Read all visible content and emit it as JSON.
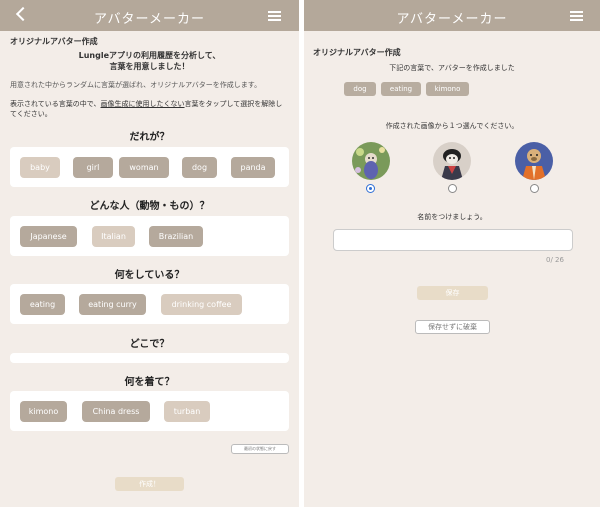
{
  "left": {
    "header": {
      "title": "アバターメーカー"
    },
    "heading": "オリジナルアバター作成",
    "intro_line1": "Lungleアプリの利用履歴を分析して、",
    "intro_line2": "言葉を用意しました！",
    "desc": "用意された中からランダムに言葉が選ばれ、オリジナルアバターを作成します。",
    "instruction_1": "表示されている言葉の中で、",
    "instruction_link": "画像生成に使用したくない",
    "instruction_2": "言葉をタップして選択を解除し",
    "instruction_3": "てください。",
    "sections": [
      {
        "title": "だれが？",
        "chips": [
          {
            "label": "baby",
            "active": false
          },
          {
            "label": "girl",
            "active": true
          },
          {
            "label": "woman",
            "active": true
          },
          {
            "label": "dog",
            "active": true
          },
          {
            "label": "panda",
            "active": true
          }
        ]
      },
      {
        "title": "どんな人（動物・もの）？",
        "chips": [
          {
            "label": "Japanese",
            "active": true
          },
          {
            "label": "Italian",
            "active": false
          },
          {
            "label": "Brazilian",
            "active": true
          }
        ]
      },
      {
        "title": "何をしている？",
        "chips": [
          {
            "label": "eating",
            "active": true
          },
          {
            "label": "eating curry",
            "active": true
          },
          {
            "label": "drinking coffee",
            "active": false
          }
        ]
      },
      {
        "title": "どこで？",
        "chips": []
      },
      {
        "title": "何を着て？",
        "chips": [
          {
            "label": "kimono",
            "active": true
          },
          {
            "label": "China dress",
            "active": true
          },
          {
            "label": "turban",
            "active": false
          }
        ]
      }
    ],
    "reset_label": "最初の状態に戻す",
    "create_label": "作成！"
  },
  "right": {
    "header": {
      "title": "アバターメーカー"
    },
    "heading": "オリジナルアバター作成",
    "created_with": "下記の言葉で、アバターを作成しました",
    "tags": [
      "dog",
      "eating",
      "kimono"
    ],
    "choose_prompt": "作成された画像から１つ選んでください。",
    "avatars": [
      {
        "icon": "avatar-dog-flowers-icon",
        "selected": true
      },
      {
        "icon": "avatar-dog-kimono-icon",
        "selected": false
      },
      {
        "icon": "avatar-dog-orange-robe-icon",
        "selected": false
      }
    ],
    "name_prompt": "名前をつけましょう。",
    "name_value": "",
    "name_placeholder": "",
    "char_count": "0/ 26",
    "save_label": "保存",
    "discard_label": "保存せずに破棄"
  },
  "colors": {
    "header": "#b4a89a",
    "background": "#f3ede8",
    "chip_active": "#b5a99c",
    "chip_inactive": "#d9ccbf",
    "button": "#e8dcc8"
  }
}
